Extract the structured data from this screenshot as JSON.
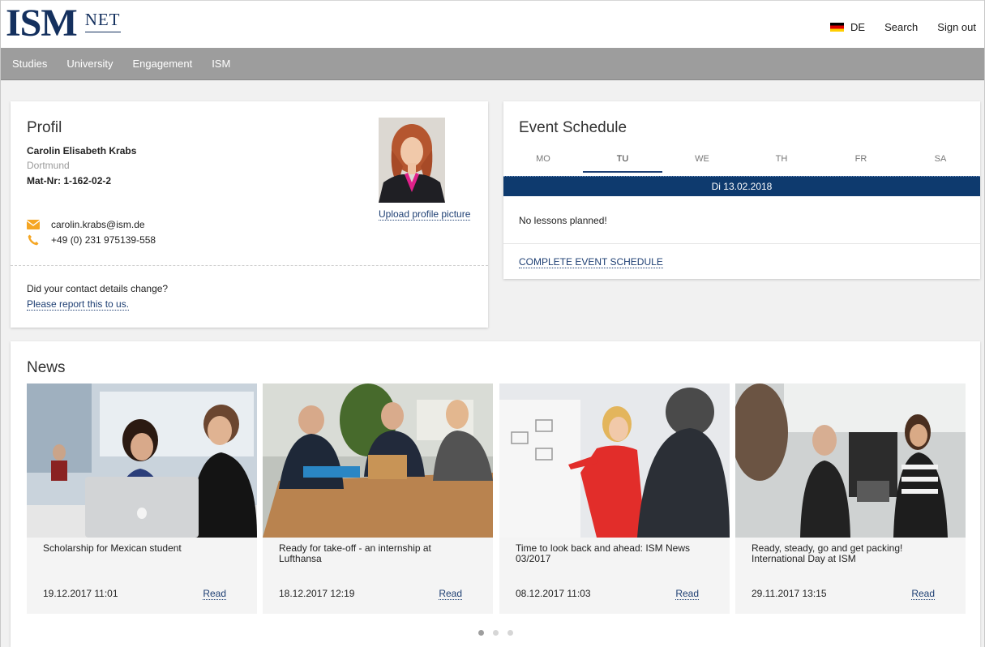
{
  "header": {
    "logo_main": "ISM",
    "logo_sub": "NET",
    "language": "DE",
    "search": "Search",
    "signout": "Sign out"
  },
  "nav": {
    "items": [
      "Studies",
      "University",
      "Engagement",
      "ISM"
    ]
  },
  "profile": {
    "title": "Profil",
    "name": "Carolin Elisabeth Krabs",
    "city": "Dortmund",
    "mat_nr": "Mat-Nr: 1-162-02-2",
    "email": "carolin.krabs@ism.de",
    "phone": "+49 (0) 231 975139-558",
    "upload_label": "Upload profile picture",
    "question": "Did your contact details change?",
    "report_link": "Please report this to us."
  },
  "schedule": {
    "title": "Event Schedule",
    "days": [
      "MO",
      "TU",
      "WE",
      "TH",
      "FR",
      "SA"
    ],
    "active_day": "TU",
    "date": "Di 13.02.2018",
    "empty_message": "No lessons planned!",
    "complete_link": "COMPLETE EVENT SCHEDULE"
  },
  "news": {
    "title": "News",
    "items": [
      {
        "title": "Scholarship for Mexican student",
        "date": "19.12.2017 11:01",
        "read": "Read"
      },
      {
        "title": "Ready for take-off - an internship at Lufthansa",
        "date": "18.12.2017 12:19",
        "read": "Read"
      },
      {
        "title": "Time to look back and ahead: ISM News 03/2017",
        "date": "08.12.2017 11:03",
        "read": "Read"
      },
      {
        "title": "Ready, steady, go and get packing! International Day at ISM",
        "date": "29.11.2017 13:15",
        "read": "Read"
      }
    ],
    "carousel_pages": 3,
    "carousel_active": 1
  },
  "colors": {
    "brand": "#14305e",
    "link": "#1e3f73",
    "nav_bg": "#9d9d9d",
    "date_bar": "#0e3a6e",
    "icon_orange": "#f5a623"
  },
  "icons": [
    "email-icon",
    "phone-icon",
    "germany-flag-icon"
  ]
}
